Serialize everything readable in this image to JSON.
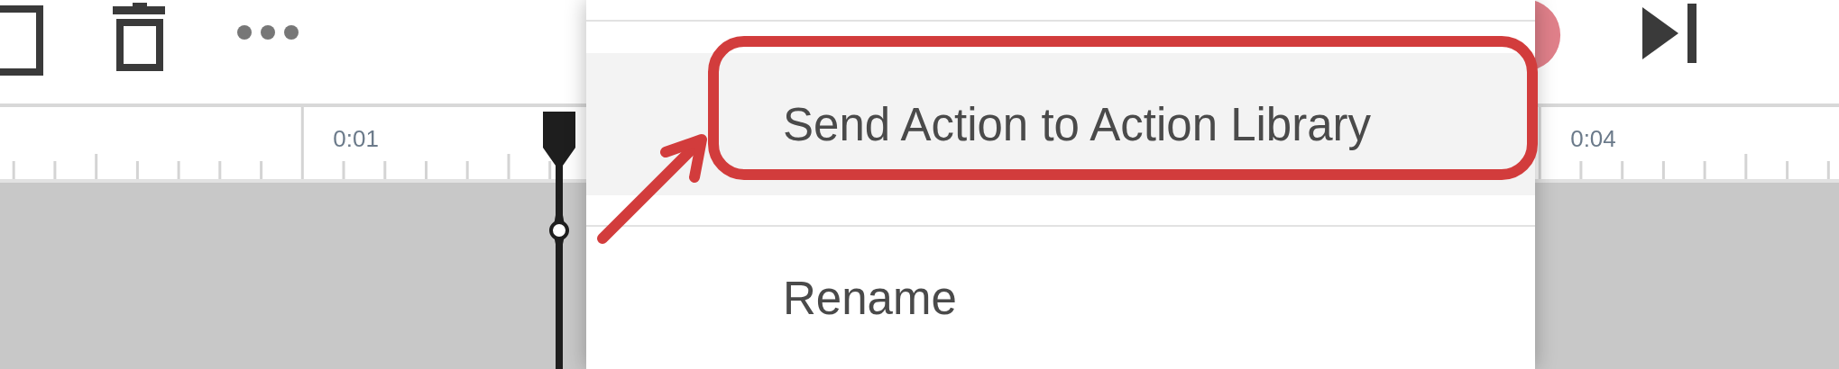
{
  "toolbar": {
    "left_icons": [
      {
        "kind": "square"
      },
      {
        "kind": "trash"
      },
      {
        "kind": "more"
      }
    ],
    "right_icons": [
      {
        "kind": "record"
      },
      {
        "kind": "skip-end"
      }
    ]
  },
  "ruler": {
    "labels": [
      {
        "text": "0:01"
      },
      {
        "text": "0:04"
      }
    ]
  },
  "context_menu": {
    "items": [
      {
        "label": "Send Action to Action Library",
        "selected": true,
        "annotated": true
      },
      {
        "label": "Rename",
        "selected": false,
        "annotated": false
      }
    ]
  }
}
